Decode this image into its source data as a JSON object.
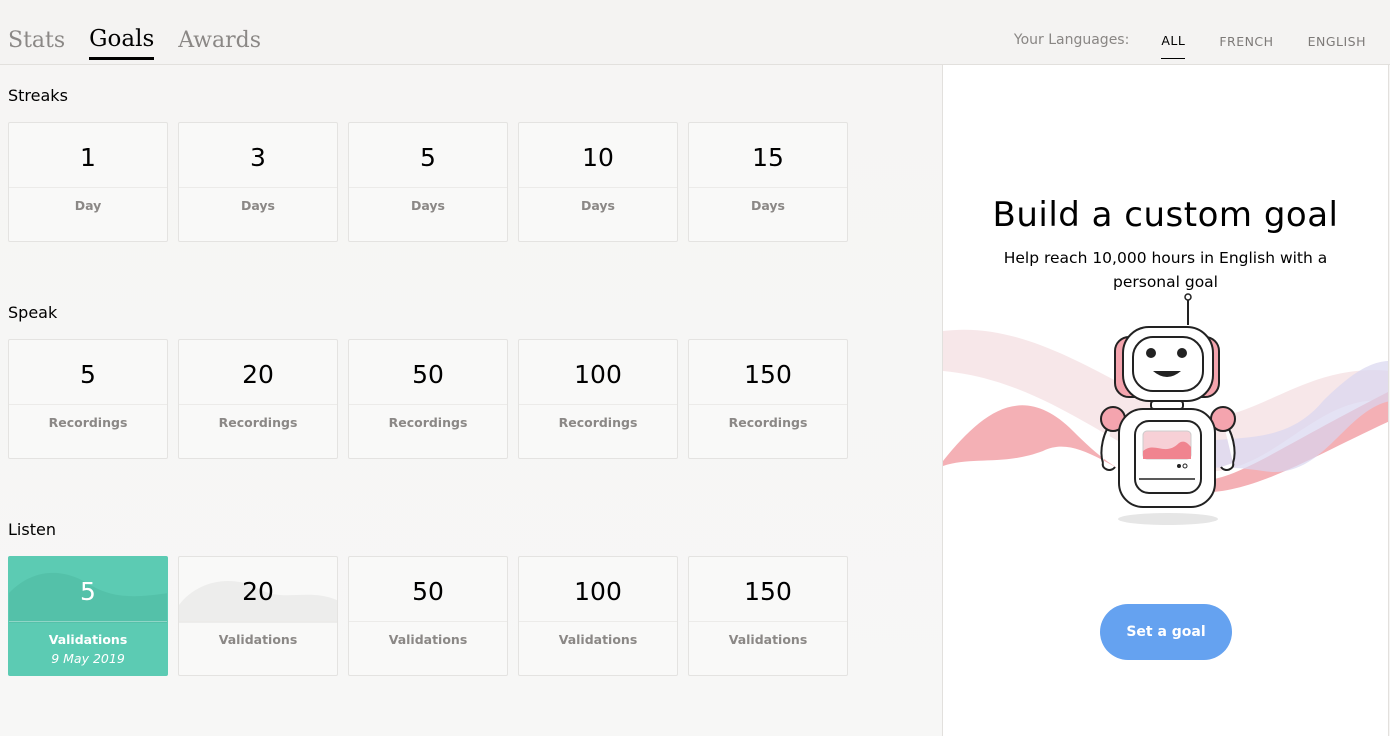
{
  "tabs": [
    {
      "label": "Stats",
      "active": false
    },
    {
      "label": "Goals",
      "active": true
    },
    {
      "label": "Awards",
      "active": false
    }
  ],
  "languages": {
    "title": "Your Languages:",
    "items": [
      {
        "label": "ALL",
        "active": true
      },
      {
        "label": "FRENCH",
        "active": false
      },
      {
        "label": "ENGLISH",
        "active": false
      }
    ]
  },
  "sections": [
    {
      "title": "Streaks",
      "cards": [
        {
          "value": "1",
          "unit": "Day",
          "done": false
        },
        {
          "value": "3",
          "unit": "Days",
          "done": false
        },
        {
          "value": "5",
          "unit": "Days",
          "done": false
        },
        {
          "value": "10",
          "unit": "Days",
          "done": false
        },
        {
          "value": "15",
          "unit": "Days",
          "done": false
        }
      ]
    },
    {
      "title": "Speak",
      "cards": [
        {
          "value": "5",
          "unit": "Recordings",
          "done": false
        },
        {
          "value": "20",
          "unit": "Recordings",
          "done": false
        },
        {
          "value": "50",
          "unit": "Recordings",
          "done": false
        },
        {
          "value": "100",
          "unit": "Recordings",
          "done": false
        },
        {
          "value": "150",
          "unit": "Recordings",
          "done": false
        }
      ]
    },
    {
      "title": "Listen",
      "cards": [
        {
          "value": "5",
          "unit": "Validations",
          "done": true,
          "date": "9 May 2019"
        },
        {
          "value": "20",
          "unit": "Validations",
          "done": false,
          "in_progress": true
        },
        {
          "value": "50",
          "unit": "Validations",
          "done": false
        },
        {
          "value": "100",
          "unit": "Validations",
          "done": false
        },
        {
          "value": "150",
          "unit": "Validations",
          "done": false
        }
      ]
    }
  ],
  "panel": {
    "title": "Build a custom goal",
    "subtitle": "Help reach 10,000 hours in English with a personal goal",
    "button": "Set a goal",
    "illustration": "robot-illustration"
  },
  "colors": {
    "done": "#5ccbb3",
    "button": "#65a2f0",
    "wave_pink": "#f2a2a8",
    "wave_lilac": "#d8d6ef"
  }
}
